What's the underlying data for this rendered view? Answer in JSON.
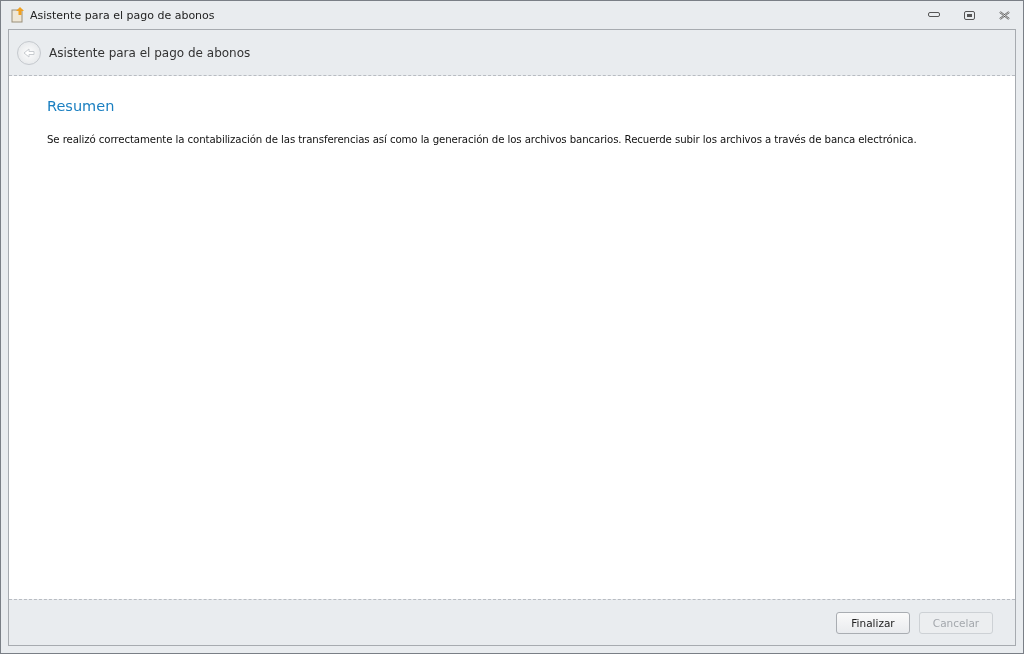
{
  "window": {
    "title": "Asistente para el pago de abonos"
  },
  "header": {
    "title": "Asistente para el pago de abonos"
  },
  "content": {
    "heading": "Resumen",
    "message": "Se realizó correctamente la contabilización de las transferencias así como la generación de los archivos bancarios. Recuerde subir los archivos a través de banca electrónica."
  },
  "buttons": [
    {
      "label": "Finalizar",
      "disabled": false
    },
    {
      "label": "Cancelar",
      "disabled": true
    }
  ]
}
